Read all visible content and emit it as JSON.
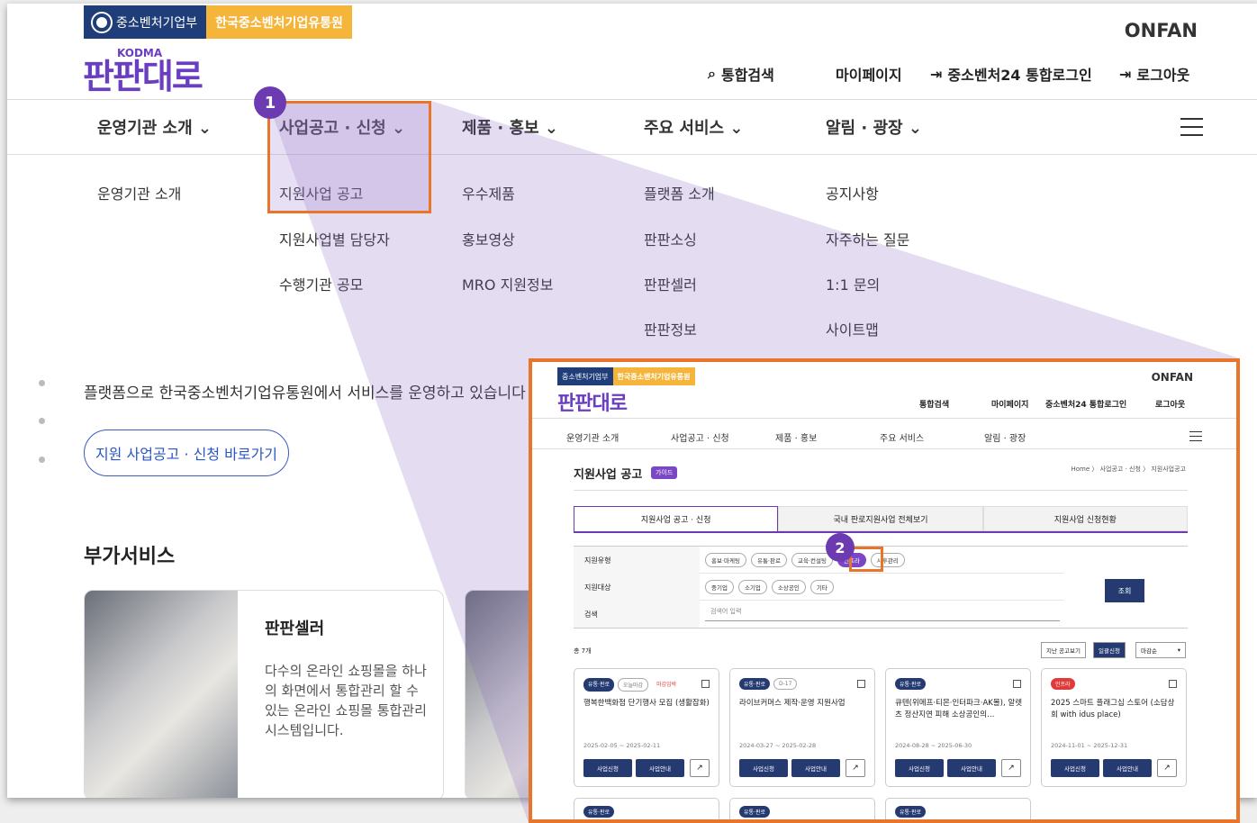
{
  "header": {
    "gov_label": "중소벤처기업부",
    "org_label": "한국중소벤처기업유통원",
    "onfan": "ONFAN",
    "logo_sub": "KODMA",
    "logo_text": "판판대로",
    "util": [
      "통합검색",
      "마이페이지",
      "중소벤처24 통합로그인",
      "로그아웃"
    ]
  },
  "gnb": [
    "운영기관 소개",
    "사업공고 · 신청",
    "제품 · 홍보",
    "주요 서비스",
    "알림 · 광장"
  ],
  "submenu": {
    "col1": [
      "운영기관 소개"
    ],
    "col2": [
      "지원사업 공고",
      "지원사업별 담당자",
      "수행기관 공모"
    ],
    "col3": [
      "우수제품",
      "홍보영상",
      "MRO 지원정보"
    ],
    "col4": [
      "플랫폼 소개",
      "판판소싱",
      "판판셀러",
      "판판정보"
    ],
    "col5": [
      "공지사항",
      "자주하는 질문",
      "1:1 문의",
      "사이트맵"
    ]
  },
  "badges": [
    "1",
    "2"
  ],
  "main": {
    "body_text": "플랫폼으로 한국중소벤처기업유통원에서 서비스를 운영하고 있습니다",
    "go_link": "지원 사업공고 · 신청 바로가기",
    "section_title": "부가서비스",
    "card_title": "판판셀러",
    "card_desc": "다수의 온라인 쇼핑몰을 하나의 화면에서 통합관리 할 수 있는 온라인 쇼핑몰 통합관리 시스템입니다."
  },
  "inset": {
    "gnb": [
      "운영기관 소개",
      "사업공고 · 신청",
      "제품 · 홍보",
      "주요 서비스",
      "알림 · 광장"
    ],
    "util": [
      "통합검색",
      "마이페이지",
      "중소벤처24 통합로그인",
      "로그아웃"
    ],
    "page_title": "지원사업 공고",
    "guide": "가이드",
    "breadcrumb": "Home 〉 사업공고 · 신청 〉 지원사업공고",
    "tabs": [
      "지원사업 공고 · 신청",
      "국내 판로지원사업 전체보기",
      "지원사업 신청현황"
    ],
    "filters": {
      "type_label": "지원유형",
      "type_chips": [
        "홍보·마케팅",
        "유통·판로",
        "교육·컨설팅",
        "인프라",
        "사후관리"
      ],
      "target_label": "지원대상",
      "target_chips": [
        "중기업",
        "소기업",
        "소상공인",
        "기타"
      ],
      "search_label": "검색",
      "search_placeholder": "검색어 입력",
      "submit": "조회"
    },
    "count": "총 7개",
    "sort_buttons": [
      "지난 공고보기",
      "일괄신청",
      "마감순"
    ],
    "cards": [
      {
        "tag": "유통·판로",
        "tag2": "오늘마감",
        "tag3": "마감임박",
        "title": "행복한백화점 단기행사 모집 (생활잡화)",
        "date": "2025-02-05 ~ 2025-02-11"
      },
      {
        "tag": "유통·판로",
        "tag2": "D-17",
        "tag3": "",
        "title": "라이브커머스 제작·운영 지원사업",
        "date": "2024-03-27 ~ 2025-02-28"
      },
      {
        "tag": "유통·판로",
        "tag2": "",
        "tag3": "",
        "title": "큐텐(위메프·티몬·인터파크·AK몰), 알렛츠 정산지연 피해 소상공인의…",
        "date": "2024-08-28 ~ 2025-06-30"
      },
      {
        "tag": "인프라",
        "tag2": "",
        "tag3": "",
        "title": "2025 스마트 플래그십 스토어 (소담상회 with idus place)",
        "date": "2024-11-01 ~ 2025-12-31"
      }
    ],
    "card_apply": "사업신청",
    "card_info": "사업안내",
    "more_tag": "유통·판로"
  },
  "colors": {
    "accent": "#6c3bb2",
    "highlight": "#e8752a",
    "navy": "#263a72"
  }
}
